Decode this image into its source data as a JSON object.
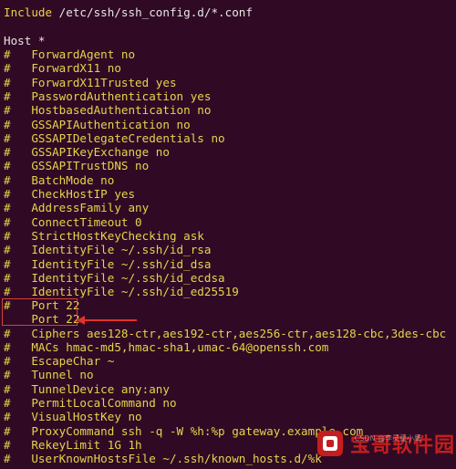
{
  "terminal": {
    "include_line": {
      "keyword": "Include",
      "arg": " /etc/ssh/ssh_config.d/*.conf"
    },
    "host_line": "Host *",
    "lines": [
      "#   ForwardAgent no",
      "#   ForwardX11 no",
      "#   ForwardX11Trusted yes",
      "#   PasswordAuthentication yes",
      "#   HostbasedAuthentication no",
      "#   GSSAPIAuthentication no",
      "#   GSSAPIDelegateCredentials no",
      "#   GSSAPIKeyExchange no",
      "#   GSSAPITrustDNS no",
      "#   BatchMode no",
      "#   CheckHostIP yes",
      "#   AddressFamily any",
      "#   ConnectTimeout 0",
      "#   StrictHostKeyChecking ask",
      "#   IdentityFile ~/.ssh/id_rsa",
      "#   IdentityFile ~/.ssh/id_dsa",
      "#   IdentityFile ~/.ssh/id_ecdsa",
      "#   IdentityFile ~/.ssh/id_ed25519",
      "#   Port 22"
    ],
    "active_line": "    Port 22",
    "lines_after": [
      "#   Ciphers aes128-ctr,aes192-ctr,aes256-ctr,aes128-cbc,3des-cbc",
      "#   MACs hmac-md5,hmac-sha1,umac-64@openssh.com",
      "#   EscapeChar ~",
      "#   Tunnel no",
      "#   TunnelDevice any:any",
      "#   PermitLocalCommand no",
      "#   VisualHostKey no",
      "#   ProxyCommand ssh -q -W %h:%p gateway.example.com",
      "#   RekeyLimit 1G 1h",
      "#   UserKnownHostsFile ~/.ssh/known_hosts.d/%k"
    ]
  },
  "watermark": {
    "title": "宝哥软件园",
    "sub": "CSDN @李灵童小鹰"
  },
  "colors": {
    "background": "#300a24",
    "text": "#e6e6e6",
    "comment": "#e6d34c",
    "annotation": "#e0322c",
    "watermark": "#c41e1e"
  }
}
